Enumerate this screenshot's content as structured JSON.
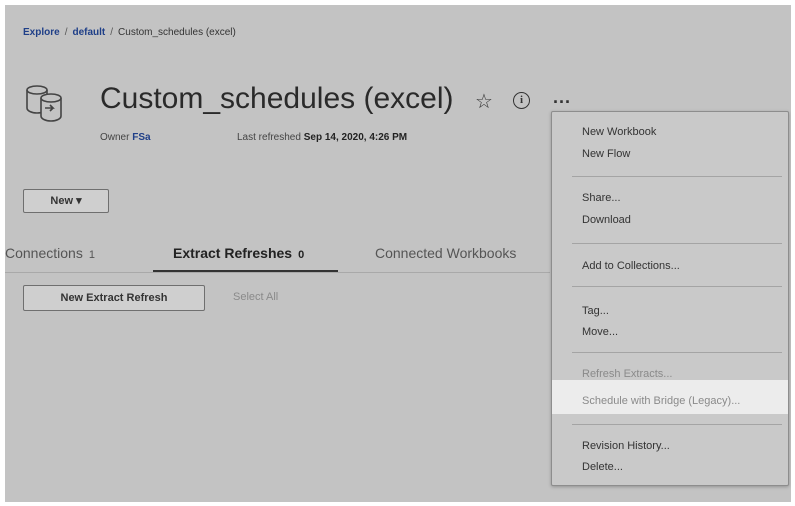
{
  "breadcrumb": {
    "explore": "Explore",
    "sep": "/",
    "project": "default",
    "current": "Custom_schedules (excel)"
  },
  "header": {
    "title": "Custom_schedules (excel)",
    "star_icon": "star-icon",
    "info_icon": "info-icon",
    "more_label": "...",
    "owner_label": "Owner",
    "owner_value": "FSa",
    "refreshed_label": "Last refreshed",
    "refreshed_value": "Sep 14, 2020, 4:26 PM"
  },
  "toolbar": {
    "new_label": "New ▾"
  },
  "tabs": [
    {
      "label": "Connections",
      "count": "1"
    },
    {
      "label": "Extract Refreshes",
      "count": "0"
    },
    {
      "label": "Connected Workbooks",
      "count": ""
    }
  ],
  "actions": {
    "new_extract_refresh": "New Extract Refresh",
    "select_all": "Select All"
  },
  "menu": {
    "new_workbook": "New Workbook",
    "new_flow": "New Flow",
    "share": "Share...",
    "download": "Download",
    "add_to_collections": "Add to Collections...",
    "tag": "Tag...",
    "move": "Move...",
    "refresh_extracts": "Refresh Extracts...",
    "schedule_with_bridge": "Schedule with Bridge (Legacy)...",
    "revision_history": "Revision History...",
    "delete": "Delete..."
  },
  "colors": {
    "overlay": "#c3c3c3",
    "link": "#1f3f88",
    "highlight": "#ececec"
  }
}
